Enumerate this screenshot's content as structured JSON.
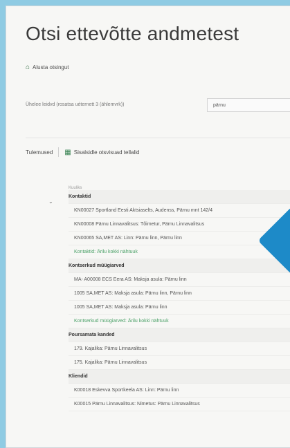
{
  "page": {
    "title": "Otsi ettevõtte andmetest",
    "new_search": "Alusta otsingut"
  },
  "search": {
    "label": "Ühelee leidvd (rosatsa uéternett 3 (ählemvrk))",
    "value": "pärnu"
  },
  "results": {
    "label": "Tulemused",
    "export": "Sisalsidle otsvisuad tellalid",
    "column_header": "Kuuliks"
  },
  "groups": [
    {
      "header": "Kontaktid",
      "items": [
        "KN00027 Sportland Eesti Aktsiaselts, Audenss, Pärnu mnt 142/4",
        "KN00008 Pärnu Linnavalitsus: Tõimetur, Pärnu Linnavalitsus",
        "KN00065 SA,MET AS: Linn: Pärnu linn, Pärnu linn"
      ],
      "more": "Kontaktid: Ärilu kokki nähtuuk"
    },
    {
      "header": "Kontserkud müügiarved",
      "items": [
        "MA- A00008 ECS Eera AS: Maksja asula: Pärnu linn",
        "1005 SA,MET AS: Maksja asula: Pärnu linn, Pärnu linn",
        "1005 SA,MET AS: Maksja asula: Pärnu linn"
      ],
      "more": "Kontserkud müügiarved: Ärilu kokki nähtuuk"
    },
    {
      "header": "Poursamata kanded",
      "items": [
        "179. Kajalika: Pärnu Linnavalitsus",
        "175. Kajalika: Pärnu Linnavalitsus"
      ]
    },
    {
      "header": "Kliendid",
      "items": [
        "K00018 Eskevva Sportkeela AS: Linn: Pärnu linn",
        "K00015 Pärnu Linnavalitsus: Nimetus: Pärnu Linnavalitsus"
      ]
    }
  ],
  "colors": {
    "background": "#8fcbe3",
    "accent_blue": "#1d8ac8",
    "green_link": "#4aa067"
  },
  "icons": {
    "new_search": "home-icon",
    "export": "excel-icon",
    "expander": "chevron-down-icon"
  }
}
